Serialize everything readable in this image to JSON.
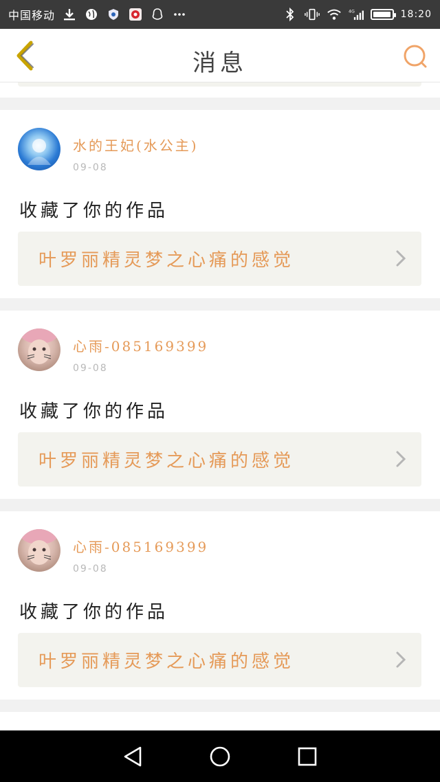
{
  "status_bar": {
    "carrier": "中国移动",
    "time": "18:20",
    "network": "4G",
    "battery_level": 0.85
  },
  "header": {
    "title": "消息"
  },
  "messages": [
    {
      "username": "水的王妃(水公主)",
      "date": "09-08",
      "action": "收藏了你的作品",
      "work_title": "叶罗丽精灵梦之心痛的感觉",
      "avatar": "avatar-blue"
    },
    {
      "username": "心雨-085169399",
      "date": "09-08",
      "action": "收藏了你的作品",
      "work_title": "叶罗丽精灵梦之心痛的感觉",
      "avatar": "avatar-face"
    },
    {
      "username": "心雨-085169399",
      "date": "09-08",
      "action": "收藏了你的作品",
      "work_title": "叶罗丽精灵梦之心痛的感觉",
      "avatar": "avatar-face"
    }
  ],
  "colors": {
    "accent": "#e59a58",
    "back_arrow": "#c9a400",
    "link_bg": "#f3f3ee"
  }
}
